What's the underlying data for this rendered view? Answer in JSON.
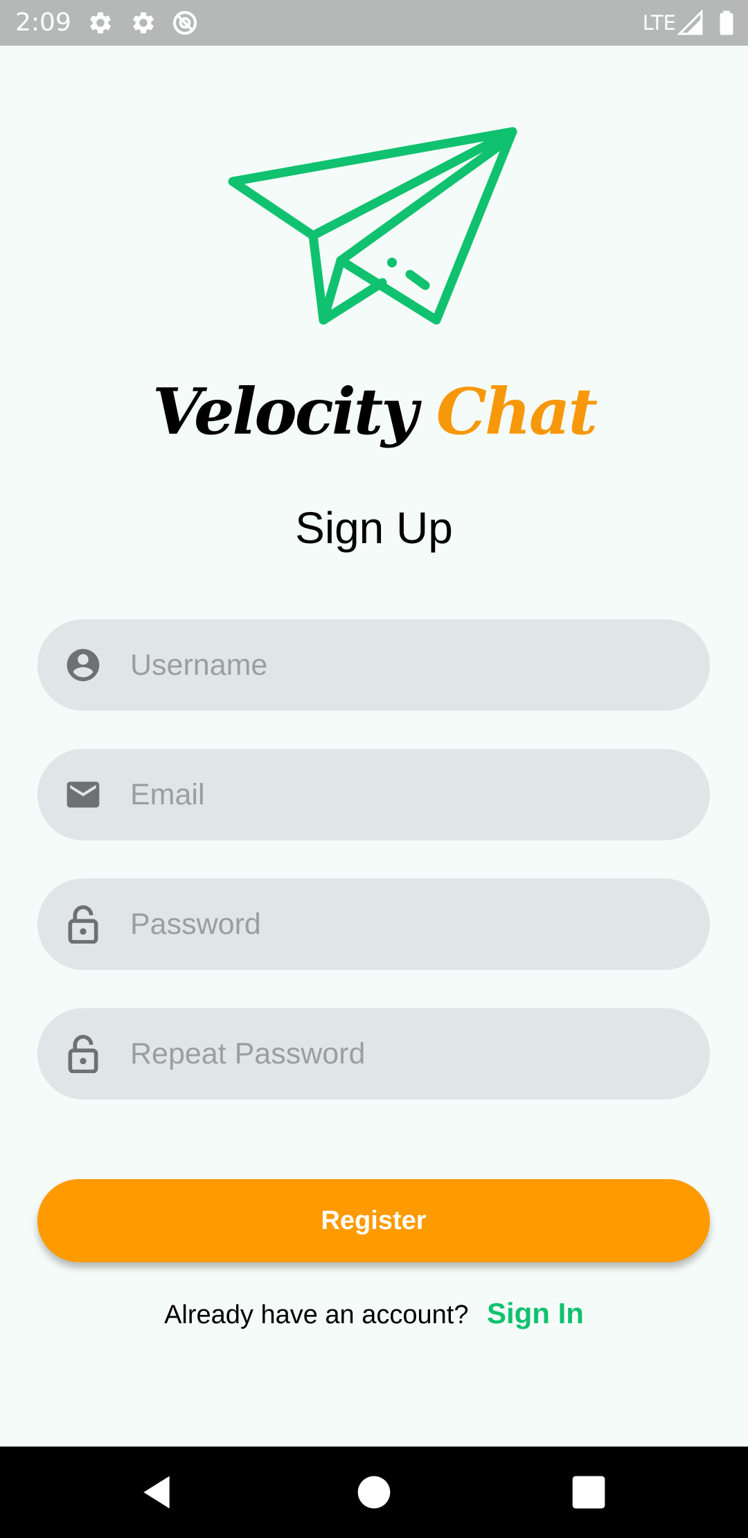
{
  "status_bar": {
    "time": "2:09",
    "network": "LTE",
    "icons": [
      "gear-icon",
      "gear-icon",
      "do-not-disturb-icon",
      "signal-icon",
      "battery-icon"
    ]
  },
  "brand": {
    "name_part1": "Velocity",
    "name_part2": "Chat",
    "logo_icon": "paper-plane-icon",
    "logo_color": "#10c16f",
    "accent_color": "#f7980a"
  },
  "page": {
    "title": "Sign Up"
  },
  "form": {
    "username": {
      "placeholder": "Username",
      "value": "",
      "icon": "person-icon"
    },
    "email": {
      "placeholder": "Email",
      "value": "",
      "icon": "mail-icon"
    },
    "password": {
      "placeholder": "Password",
      "value": "",
      "icon": "lock-icon"
    },
    "repeat_password": {
      "placeholder": "Repeat Password",
      "value": "",
      "icon": "lock-icon"
    },
    "register_label": "Register"
  },
  "footer": {
    "prompt": "Already have an account?",
    "link_label": "Sign In"
  },
  "nav_bar": {
    "icons": [
      "back-icon",
      "home-icon",
      "recents-icon"
    ]
  },
  "colors": {
    "background": "#f5fbf8",
    "field_background": "#e0e5e8",
    "primary_button": "#ff9a00",
    "link": "#10c16f"
  }
}
